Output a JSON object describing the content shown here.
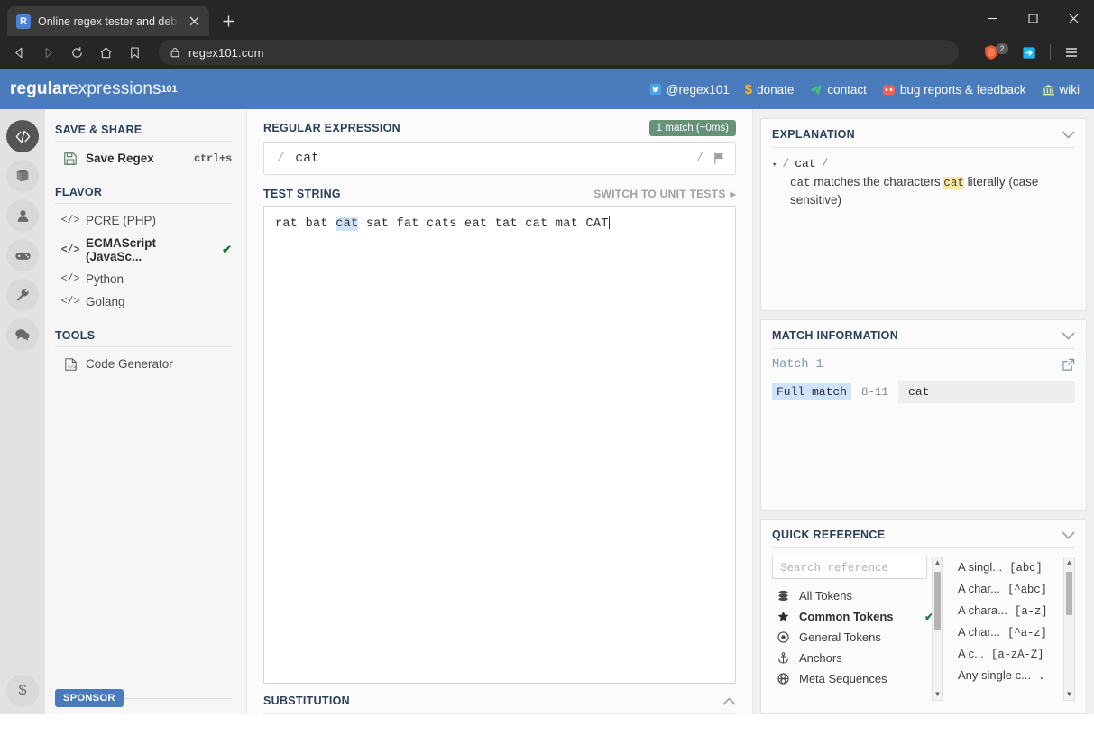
{
  "browser": {
    "tab": {
      "favicon_letter": "R",
      "title": "Online regex tester and debugger:",
      "close_icon": "close-icon"
    },
    "new_tab_label": "+",
    "window_controls": {
      "minimize": "—",
      "maximize": "□",
      "close": "✕"
    },
    "nav": {
      "back": "back-icon",
      "forward": "forward-icon",
      "reload": "reload-icon",
      "home": "home-icon",
      "bookmark": "bookmark-icon"
    },
    "url": "regex101.com",
    "lock_icon": "lock-icon",
    "shield_count": "2",
    "extension_icon": "extension-icon",
    "menu_icon": "hamburger-menu-icon"
  },
  "site_header": {
    "logo_part1": "regular",
    "logo_part2": "expressions",
    "logo_sup": "101",
    "nav": [
      {
        "icon": "twitter-icon",
        "label": "@regex101"
      },
      {
        "icon": "dollar-icon",
        "label": "donate"
      },
      {
        "icon": "telegram-icon",
        "label": "contact"
      },
      {
        "icon": "github-icon",
        "label": "bug reports & feedback"
      },
      {
        "icon": "bank-icon",
        "label": "wiki"
      }
    ]
  },
  "rail": {
    "items": [
      {
        "name": "regex-editor",
        "icon": "code-icon",
        "active": true
      },
      {
        "name": "library",
        "icon": "book-icon",
        "active": false
      },
      {
        "name": "account",
        "icon": "user-icon",
        "active": false
      },
      {
        "name": "quiz",
        "icon": "gamepad-icon",
        "active": false
      },
      {
        "name": "settings",
        "icon": "wrench-icon",
        "active": false
      },
      {
        "name": "community",
        "icon": "chat-icon",
        "active": false
      }
    ],
    "bottom": {
      "name": "sponsor",
      "icon": "dollar-icon"
    }
  },
  "sidebar": {
    "save_share_title": "SAVE & SHARE",
    "save_regex": {
      "label": "Save Regex",
      "shortcut": "ctrl+s",
      "icon": "save-icon"
    },
    "flavor_title": "FLAVOR",
    "flavors": [
      {
        "label": "PCRE (PHP)",
        "selected": false
      },
      {
        "label": "ECMAScript (JavaSc...",
        "selected": true
      },
      {
        "label": "Python",
        "selected": false
      },
      {
        "label": "Golang",
        "selected": false
      }
    ],
    "tools_title": "TOOLS",
    "tools": [
      {
        "label": "Code Generator",
        "icon": "code-file-icon"
      }
    ],
    "sponsor_label": "SPONSOR"
  },
  "editor": {
    "regex_title": "REGULAR EXPRESSION",
    "match_badge": "1 match (~0ms)",
    "open_delim": "/",
    "close_delim": "/",
    "regex_value": "cat",
    "flags": "",
    "flag_icon": "flag-icon",
    "test_string_title": "TEST STRING",
    "switch_unit_tests": "SWITCH TO UNIT TESTS",
    "test_string_before": "rat bat ",
    "test_string_match": "cat",
    "test_string_after": " sat fat cats eat tat cat mat CAT",
    "substitution_title": "SUBSTITUTION",
    "substitution_chevron": "chevron-up-icon"
  },
  "explanation": {
    "title": "EXPLANATION",
    "chevron": "chevron-down-icon",
    "disclosure": "▾",
    "pattern_open": "/",
    "pattern_token": "cat",
    "pattern_close": "/",
    "desc_prefix": "cat",
    "desc_mid": " matches the characters ",
    "desc_highlight": "cat",
    "desc_suffix": " literally (case sensitive)"
  },
  "match_information": {
    "title": "MATCH INFORMATION",
    "chevron": "chevron-down-icon",
    "match_label": "Match 1",
    "export_icon": "export-icon",
    "rows": [
      {
        "tag": "Full match",
        "range": "8-11",
        "value": "cat"
      }
    ]
  },
  "quick_reference": {
    "title": "QUICK REFERENCE",
    "chevron": "chevron-down-icon",
    "search_placeholder": "Search reference",
    "categories": [
      {
        "label": "All Tokens",
        "icon": "stack-icon",
        "selected": false
      },
      {
        "label": "Common Tokens",
        "icon": "star-icon",
        "selected": true
      },
      {
        "label": "General Tokens",
        "icon": "target-icon",
        "selected": false
      },
      {
        "label": "Anchors",
        "icon": "anchor-icon",
        "selected": false
      },
      {
        "label": "Meta Sequences",
        "icon": "globe-icon",
        "selected": false
      }
    ],
    "tokens": [
      {
        "desc": "A singl...",
        "token": "[abc]"
      },
      {
        "desc": "A char...",
        "token": "[^abc]"
      },
      {
        "desc": "A chara...",
        "token": "[a-z]"
      },
      {
        "desc": "A char...",
        "token": "[^a-z]"
      },
      {
        "desc": "A c...",
        "token": "[a-zA-Z]"
      },
      {
        "desc": "Any single c...",
        "token": "."
      }
    ]
  },
  "colors": {
    "header_blue": "#4a7cbd",
    "match_badge_green": "#67927a",
    "highlight_blue": "#cfe4fb",
    "highlight_yellow": "#fbe7a2",
    "section_title": "#2b4159"
  }
}
